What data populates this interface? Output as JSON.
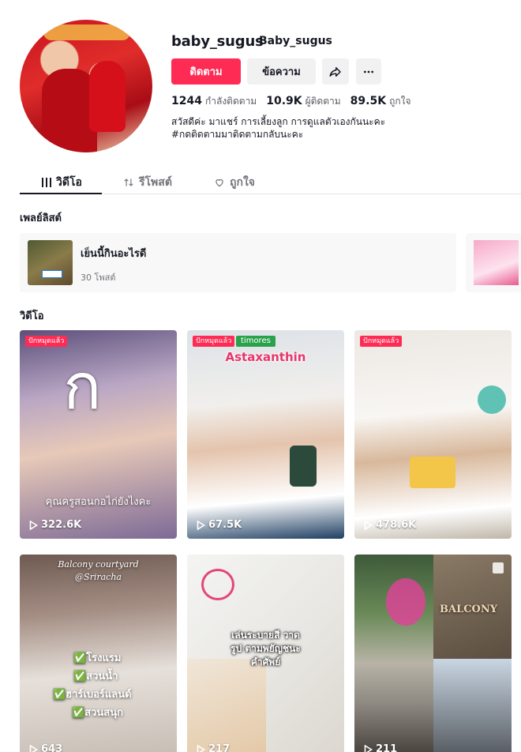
{
  "profile": {
    "username": "baby_sugus",
    "nickname": "Baby_sugus",
    "follow_label": "ติดตาม",
    "message_label": "ข้อความ",
    "following_count": "1244",
    "following_label": "กำลังติดตาม",
    "followers_count": "10.9K",
    "followers_label": "ผู้ติดตาม",
    "likes_count": "89.5K",
    "likes_label": "ถูกใจ",
    "bio_line1": "สวัสดีค่ะ มาแชร์ การเลี้ยงลูก การดูแลตัวเองกันนะคะ",
    "bio_line2": "#กดติดตามมาติดตามกลับนะคะ"
  },
  "tabs": [
    {
      "label": "วิดีโอ",
      "icon": "grid-icon"
    },
    {
      "label": "รีโพสต์",
      "icon": "repost-icon"
    },
    {
      "label": "ถูกใจ",
      "icon": "heart-icon"
    }
  ],
  "playlists": {
    "title": "เพลย์ลิสต์",
    "items": [
      {
        "name": "เย็นนี้กินอะไรดี",
        "count": "30 โพสต์"
      }
    ]
  },
  "videos": {
    "title": "วิดีโอ",
    "items": [
      {
        "badge": "ปักหมุดแล้ว",
        "views": "322.6K",
        "big_text": "ก",
        "caption": "คุณครูสอนกอไก่ยังไงคะ"
      },
      {
        "badge": "ปักหมุดแล้ว",
        "views": "67.5K",
        "tag": "timores",
        "caption": "Astaxanthin"
      },
      {
        "badge": "ปักหมุดแล้ว",
        "views": "478.6K"
      },
      {
        "views": "643",
        "title1": "Balcony courtyard",
        "title2": "@Sriracha",
        "list": [
          "✅โรงแรม",
          "✅สวนน้ำ",
          "✅ฮาร์เบอร์แลนด์",
          "✅สวนสนุก"
        ]
      },
      {
        "views": "217",
        "caption": "เล่นระบายสี วาดรูป ตามพยัญชนะ คำศัพย์"
      },
      {
        "views": "211",
        "sign": "BALCONY"
      }
    ]
  },
  "colors": {
    "accent": "#fe2c55",
    "text": "#161823",
    "muted": "#73747b"
  }
}
